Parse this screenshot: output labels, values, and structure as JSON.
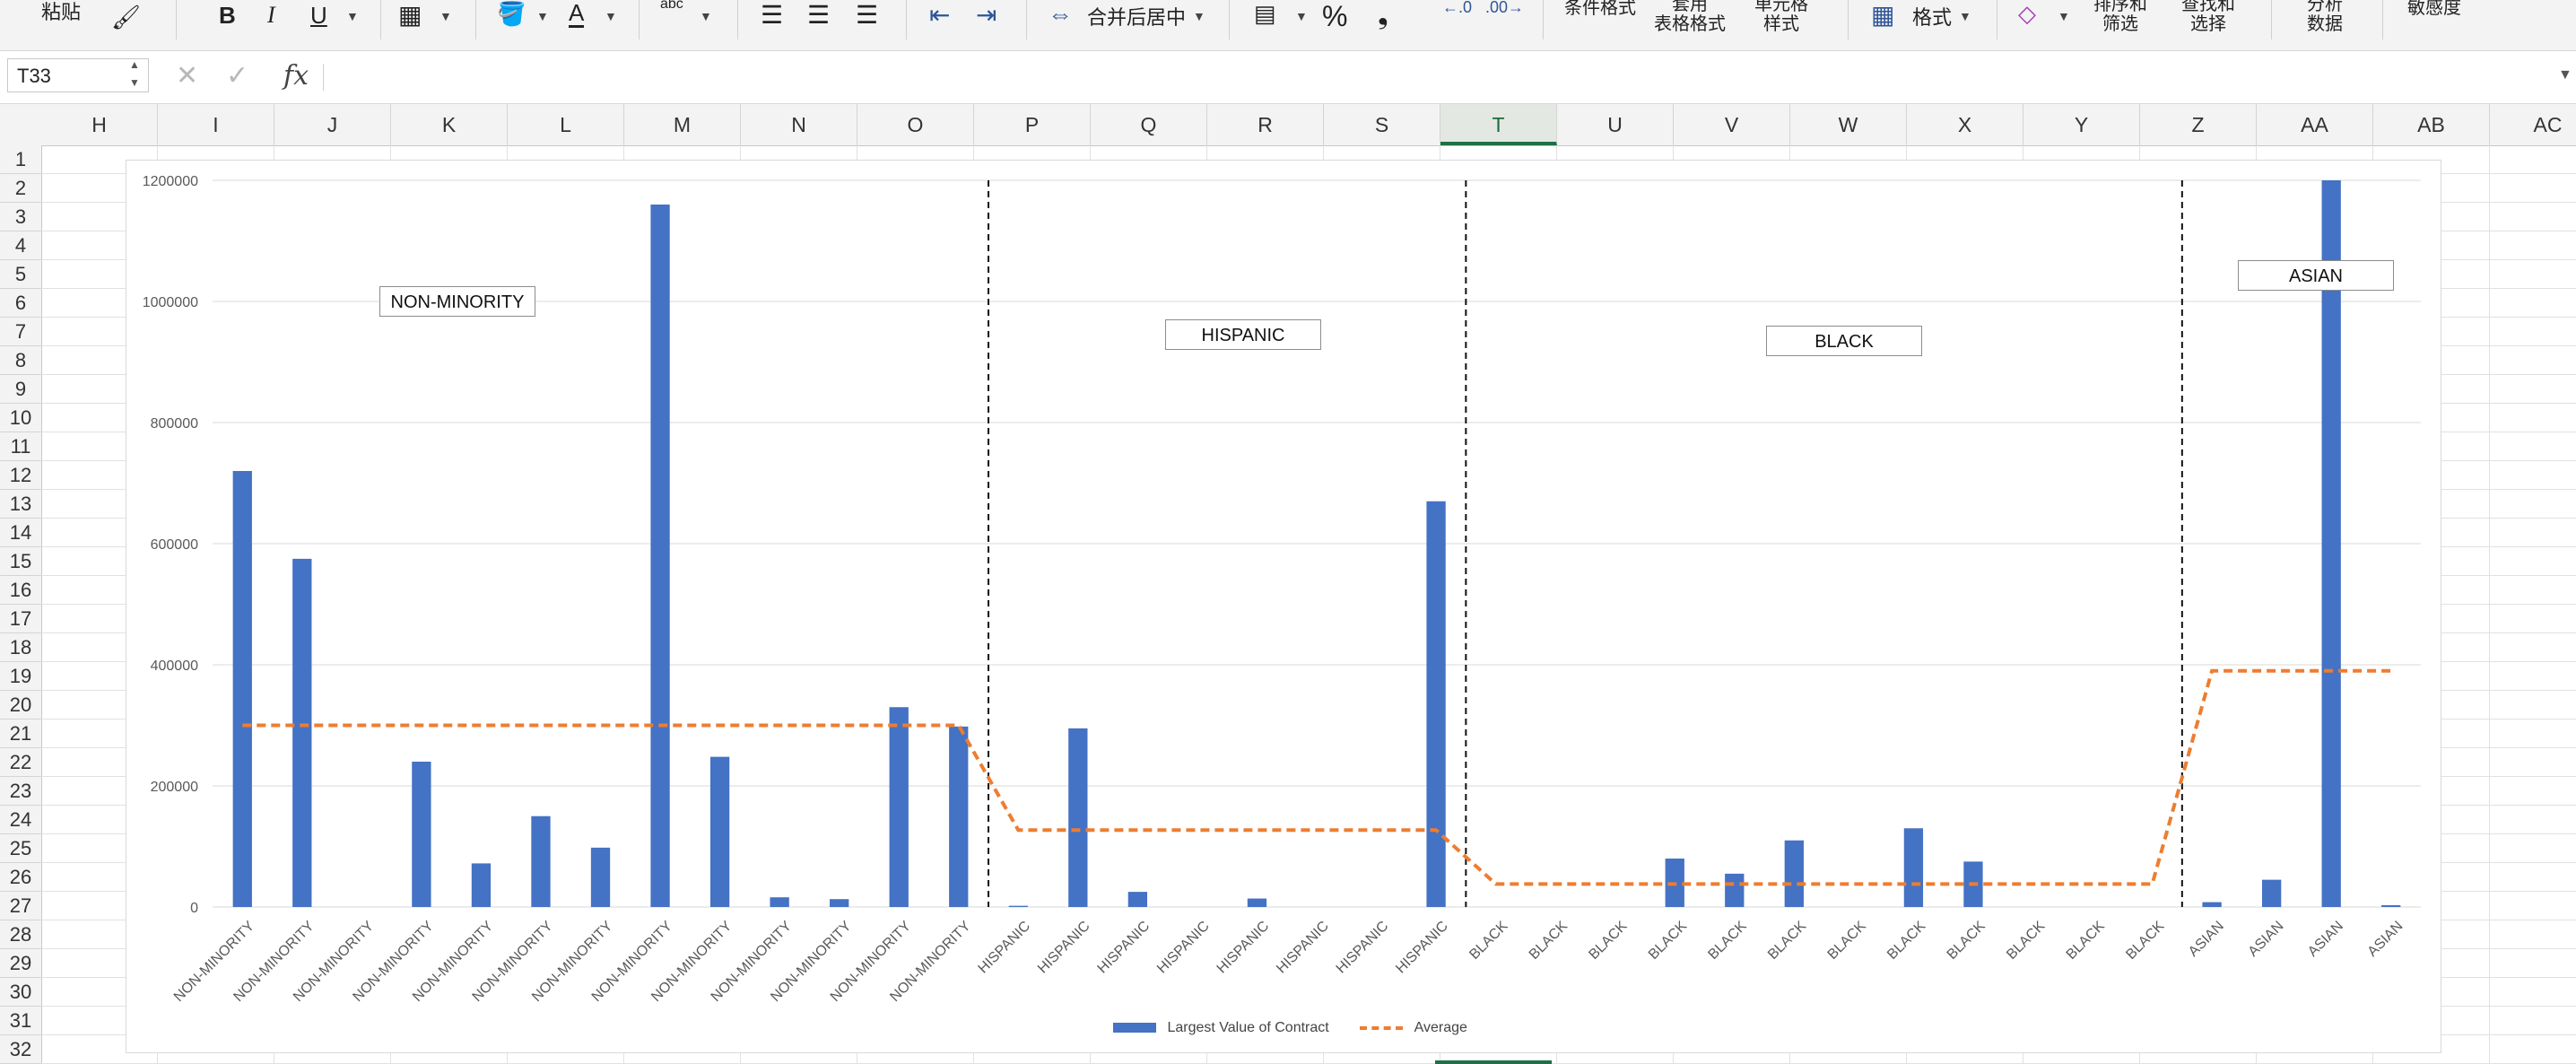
{
  "ribbon": {
    "paste_label": "粘贴",
    "bold_label": "B",
    "italic_label": "I",
    "underline_label": "U",
    "font_color_label": "A",
    "orientation_label": "abc",
    "merge_label": "合并后居中",
    "percent_label": "%",
    "comma_label": "❟",
    "cond_format_label": "条件格式",
    "table_format_line1": "套用",
    "table_format_line2": "表格格式",
    "cell_style_line1": "单元格",
    "cell_style_line2": "样式",
    "format_label": "格式",
    "sort_line1": "排序和",
    "sort_line2": "筛选",
    "find_line1": "查找和",
    "find_line2": "选择",
    "analyze_line1": "分析",
    "analyze_line2": "数据",
    "sensitivity_label": "敏感度"
  },
  "formula_bar": {
    "name_box": "T33",
    "fx_label": "fx",
    "formula": ""
  },
  "grid": {
    "columns": [
      "H",
      "I",
      "J",
      "K",
      "L",
      "M",
      "N",
      "O",
      "P",
      "Q",
      "R",
      "S",
      "T",
      "U",
      "V",
      "W",
      "X",
      "Y",
      "Z",
      "AA",
      "AB",
      "AC"
    ],
    "selected_column": "T",
    "rows": [
      "1",
      "2",
      "3",
      "4",
      "5",
      "6",
      "7",
      "8",
      "9",
      "10",
      "11",
      "12",
      "13",
      "14",
      "15",
      "16",
      "17",
      "18",
      "19",
      "20",
      "21",
      "22",
      "23",
      "24",
      "25",
      "26",
      "27",
      "28",
      "29",
      "30",
      "31",
      "32"
    ]
  },
  "chart_data": {
    "type": "bar",
    "title": "",
    "ylim": [
      0,
      1200000
    ],
    "yticks": [
      "0",
      "200000",
      "400000",
      "600000",
      "800000",
      "1000000",
      "1200000"
    ],
    "categories": [
      "NON-MINORITY",
      "NON-MINORITY",
      "NON-MINORITY",
      "NON-MINORITY",
      "NON-MINORITY",
      "NON-MINORITY",
      "NON-MINORITY",
      "NON-MINORITY",
      "NON-MINORITY",
      "NON-MINORITY",
      "NON-MINORITY",
      "NON-MINORITY",
      "NON-MINORITY",
      "HISPANIC",
      "HISPANIC",
      "HISPANIC",
      "HISPANIC",
      "HISPANIC",
      "HISPANIC",
      "HISPANIC",
      "HISPANIC",
      "BLACK",
      "BLACK",
      "BLACK",
      "BLACK",
      "BLACK",
      "BLACK",
      "BLACK",
      "BLACK",
      "BLACK",
      "BLACK",
      "BLACK",
      "BLACK",
      "ASIAN",
      "ASIAN",
      "ASIAN",
      "ASIAN"
    ],
    "series": [
      {
        "name": "Largest Value of Contract",
        "type": "bar",
        "color": "#4472c4",
        "values": [
          720000,
          575000,
          0,
          240000,
          72000,
          150000,
          98000,
          1160000,
          248000,
          16000,
          13000,
          330000,
          298000,
          2000,
          295000,
          25000,
          0,
          14000,
          0,
          0,
          670000,
          0,
          0,
          0,
          80000,
          55000,
          110000,
          0,
          130000,
          75000,
          0,
          0,
          0,
          8000,
          45000,
          1200000,
          3000
        ]
      },
      {
        "name": "Average",
        "type": "line",
        "style": "dashed",
        "color": "#ed7d31",
        "values": [
          300000,
          300000,
          300000,
          300000,
          300000,
          300000,
          300000,
          300000,
          300000,
          300000,
          300000,
          300000,
          300000,
          127000,
          127000,
          127000,
          127000,
          127000,
          127000,
          127000,
          127000,
          38000,
          38000,
          38000,
          38000,
          38000,
          38000,
          38000,
          38000,
          38000,
          38000,
          38000,
          38000,
          390000,
          390000,
          390000,
          390000
        ]
      }
    ],
    "group_labels": [
      "NON-MINORITY",
      "HISPANIC",
      "BLACK",
      "ASIAN"
    ],
    "group_dividers_after_index": [
      12,
      20,
      32
    ],
    "grid": true,
    "legend": "bottom"
  }
}
